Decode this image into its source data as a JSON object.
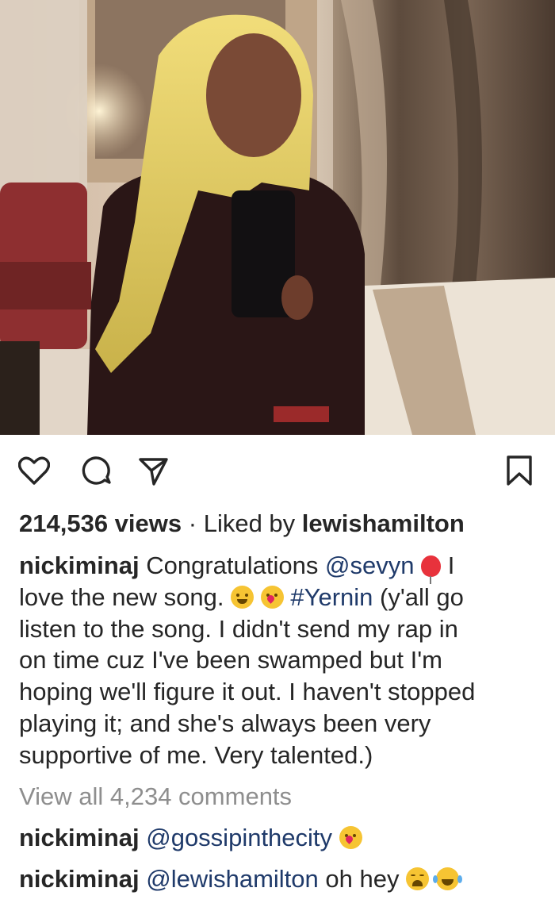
{
  "post": {
    "media": {
      "description_icon": "video-frame"
    },
    "actions": {
      "like_icon": "heart-icon",
      "comment_icon": "comment-icon",
      "share_icon": "send-icon",
      "save_icon": "bookmark-icon"
    },
    "stats": {
      "views": "214,536 views",
      "separator": "·",
      "liked_by_prefix": "Liked by",
      "liked_by_user": "lewishamilton"
    },
    "caption": {
      "username": "nickiminaj",
      "line1_text": "Congratulations",
      "line1_mention": "@sevyn",
      "line1_tail": "I",
      "line2_text": "love the new song.",
      "line2_hashtag": "#Yernin",
      "line2_tail": "(y'all go",
      "line3": "listen to the song. I didn't send my rap in",
      "line4": "on time cuz I've been swamped but I'm",
      "line5": "hoping we'll figure it out. I haven't stopped",
      "line6": "playing it; and she's always been very",
      "line7": "supportive of me. Very talented.)"
    },
    "view_all_comments": "View all 4,234 comments",
    "comments": [
      {
        "username": "nickiminaj",
        "mention": "@gossipinthecity",
        "text": ""
      },
      {
        "username": "nickiminaj",
        "mention": "@lewishamilton",
        "text": "oh hey"
      }
    ]
  }
}
